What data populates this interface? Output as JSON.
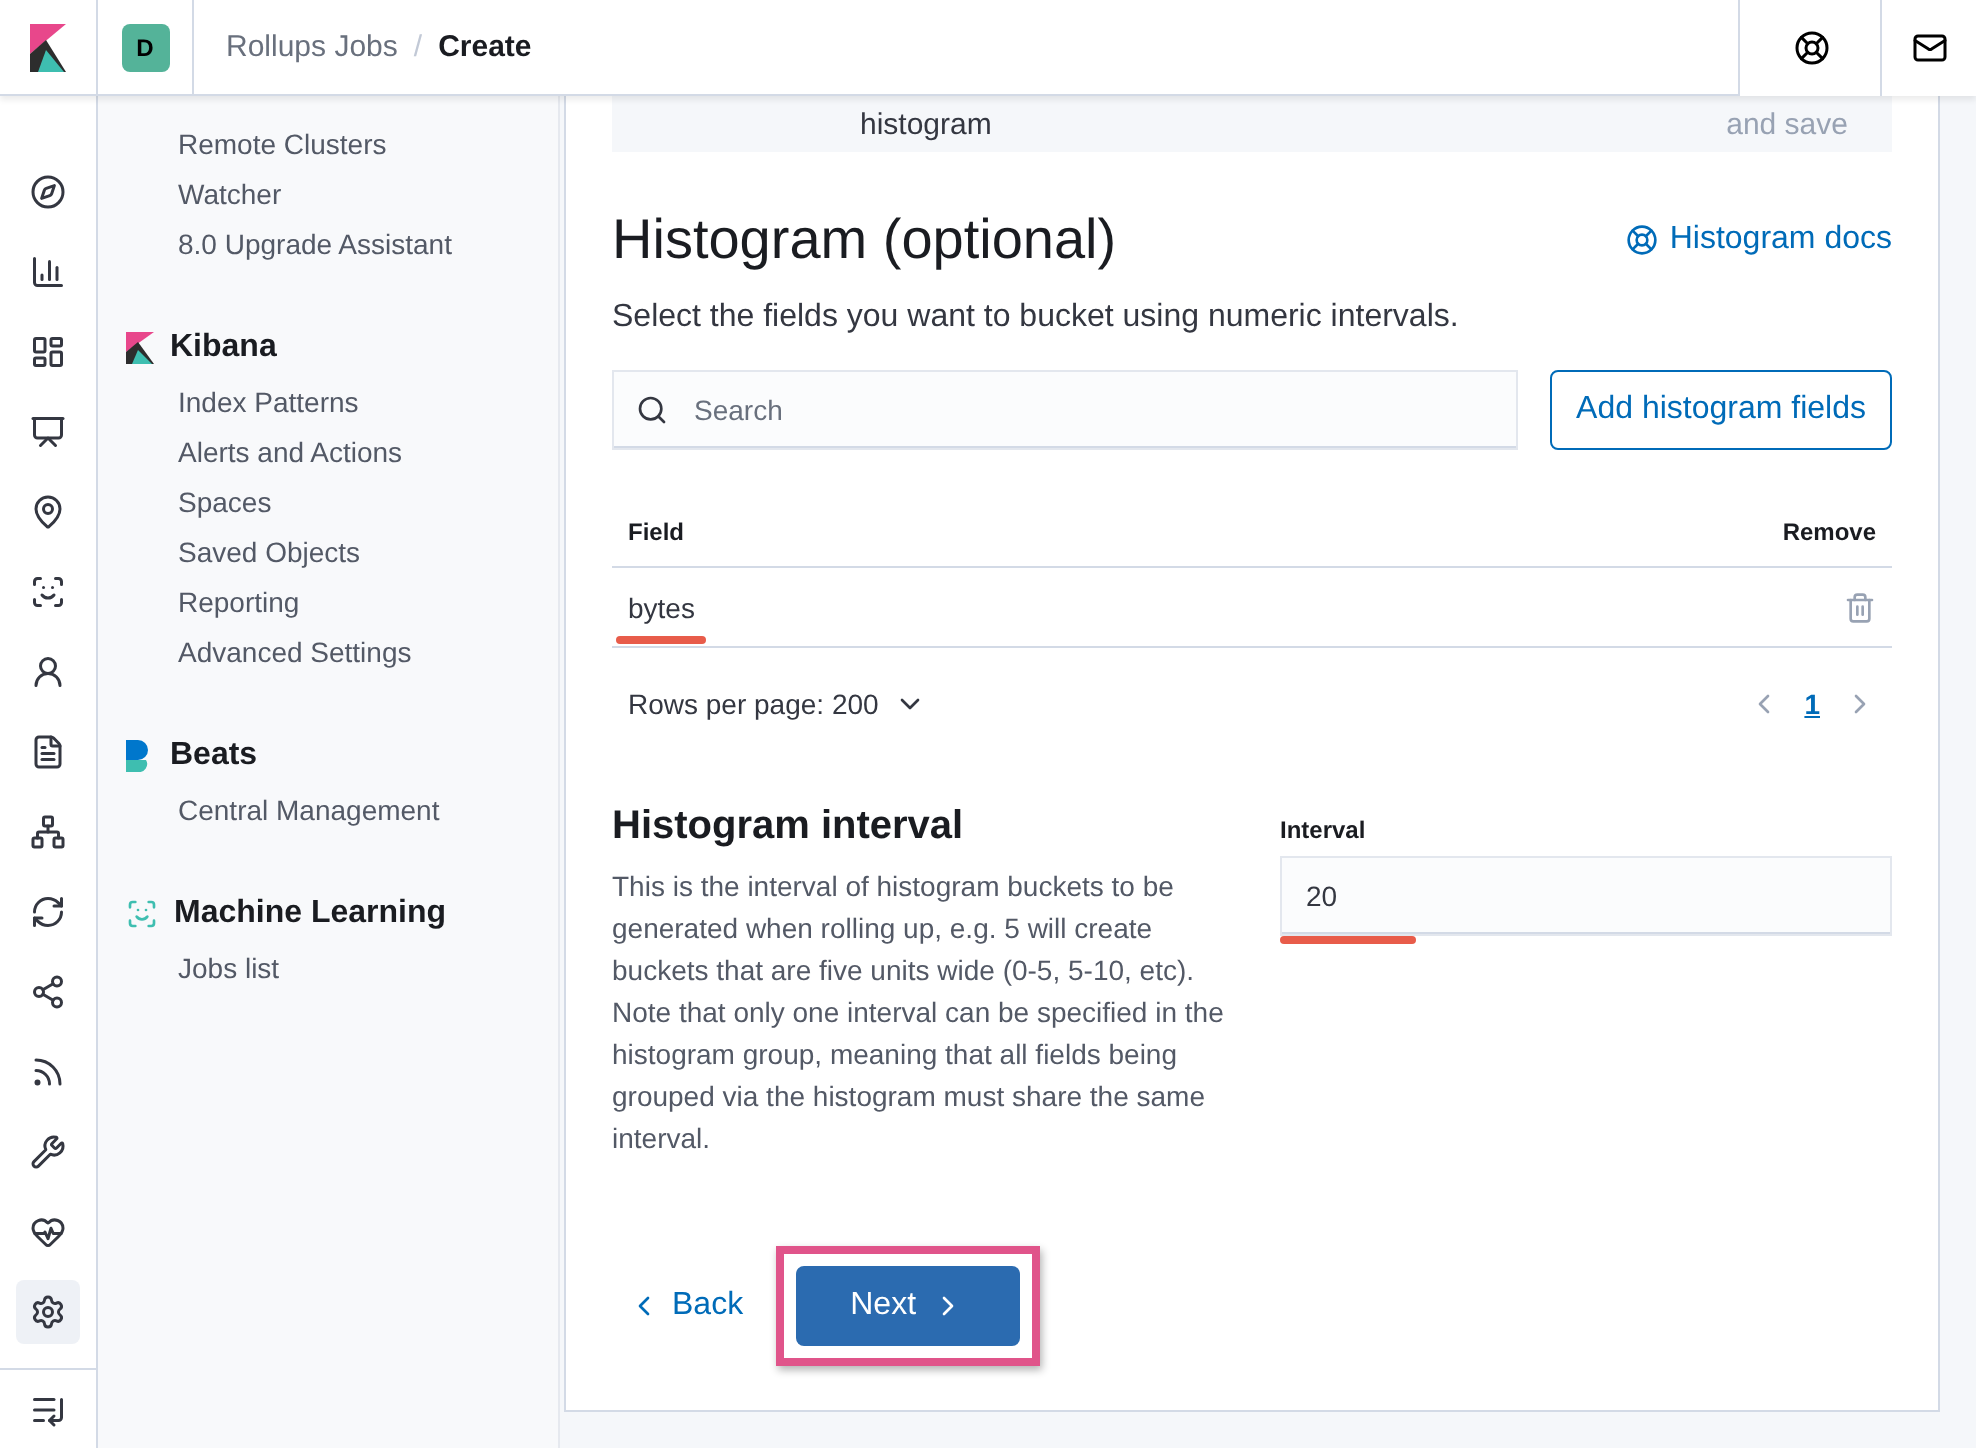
{
  "header": {
    "space_badge": "D",
    "separator": "/",
    "breadcrumbs": [
      {
        "label": "Rollups Jobs",
        "current": false
      },
      {
        "label": "Create",
        "current": true
      }
    ]
  },
  "rail": {
    "items": [
      {
        "selected": false
      },
      {
        "selected": false
      },
      {
        "selected": false
      },
      {
        "selected": false
      },
      {
        "selected": false
      },
      {
        "selected": false
      },
      {
        "selected": false
      },
      {
        "selected": false
      },
      {
        "selected": false
      },
      {
        "selected": false
      },
      {
        "selected": false
      },
      {
        "selected": false
      },
      {
        "selected": false
      },
      {
        "selected": false
      },
      {
        "selected": true
      }
    ]
  },
  "sidenav": {
    "top_items": [
      "Remote Clusters",
      "Watcher",
      "8.0 Upgrade Assistant"
    ],
    "sections": [
      {
        "title": "Kibana",
        "items": [
          "Index Patterns",
          "Alerts and Actions",
          "Spaces",
          "Saved Objects",
          "Reporting",
          "Advanced Settings"
        ]
      },
      {
        "title": "Beats",
        "items": [
          "Central Management"
        ]
      },
      {
        "title": "Machine Learning",
        "items": [
          "Jobs list"
        ]
      }
    ]
  },
  "steps": [
    "histogram",
    "and save"
  ],
  "title": "Histogram (optional)",
  "docs_link": "Histogram docs",
  "description": "Select the fields you want to bucket using numeric intervals.",
  "search": {
    "placeholder": "Search"
  },
  "add_button": "Add histogram fields",
  "table": {
    "columns": [
      "Field",
      "Remove"
    ],
    "rows": [
      {
        "field": "bytes"
      }
    ]
  },
  "pagination": {
    "rows_per_page": "Rows per page: 200",
    "pages": [
      {
        "label": "1",
        "selected": true
      }
    ]
  },
  "interval": {
    "title": "Histogram interval",
    "text": "This is the interval of histogram buckets to be generated when rolling up, e.g. 5 will create buckets that are five units wide (0-5, 5-10, etc). Note that only one interval can be specified in the histogram group, meaning that all fields being grouped via the histogram must share the same interval.",
    "label": "Interval",
    "value": "20"
  },
  "footer": {
    "back": "Back",
    "next": "Next"
  }
}
